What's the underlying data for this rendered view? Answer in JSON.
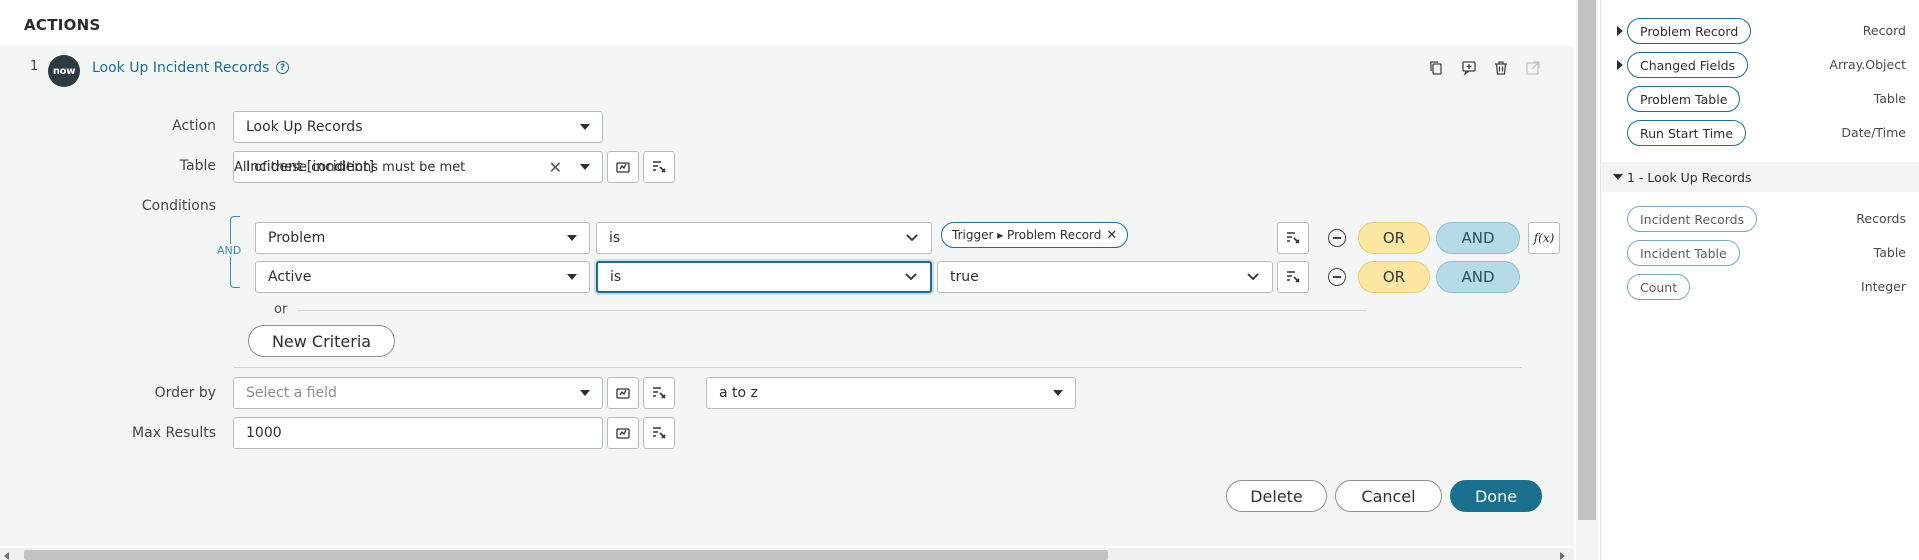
{
  "actions_title": "ACTIONS",
  "step": {
    "number": "1",
    "logo_text": "now",
    "title": "Look Up Incident Records",
    "toolbar_icons": [
      "copy-icon",
      "add-comment-icon",
      "delete-icon",
      "open-external-icon"
    ]
  },
  "form": {
    "action_label": "Action",
    "action_value": "Look Up Records",
    "table_label": "Table",
    "table_value": "Incident [incident]",
    "conditions_label": "Conditions",
    "conditions_desc": "All of these conditions must be met",
    "and_connector": "AND",
    "conditions": [
      {
        "field": "Problem",
        "operator": "is",
        "value_pill": "Trigger ▸ Problem Record",
        "or_label": "OR",
        "and_label": "AND"
      },
      {
        "field": "Active",
        "operator": "is",
        "value": "true",
        "or_label": "OR",
        "and_label": "AND"
      }
    ],
    "fx_label": "f(x)",
    "or_separator": "or",
    "new_criteria_label": "New Criteria",
    "order_by_label": "Order by",
    "order_by_placeholder": "Select a field",
    "order_direction_value": "a to z",
    "max_results_label": "Max Results",
    "max_results_value": "1000"
  },
  "footer": {
    "delete_label": "Delete",
    "cancel_label": "Cancel",
    "done_label": "Done"
  },
  "data_panel": {
    "trigger_items": [
      {
        "label": "Problem Record",
        "type": "Record",
        "expandable": true
      },
      {
        "label": "Changed Fields",
        "type": "Array.Object",
        "expandable": true
      },
      {
        "label": "Problem Table",
        "type": "Table",
        "expandable": false
      },
      {
        "label": "Run Start Time",
        "type": "Date/Time",
        "expandable": false
      }
    ],
    "section_label": "1 - Look Up Records",
    "step_items": [
      {
        "label": "Incident Records",
        "type": "Records"
      },
      {
        "label": "Incident Table",
        "type": "Table"
      },
      {
        "label": "Count",
        "type": "Integer"
      }
    ]
  },
  "colors": {
    "brand": "#1a6e8e",
    "or_pill": "#fbe7a2",
    "and_pill": "#b6dbe6",
    "card_background": "#f4f6f6"
  }
}
